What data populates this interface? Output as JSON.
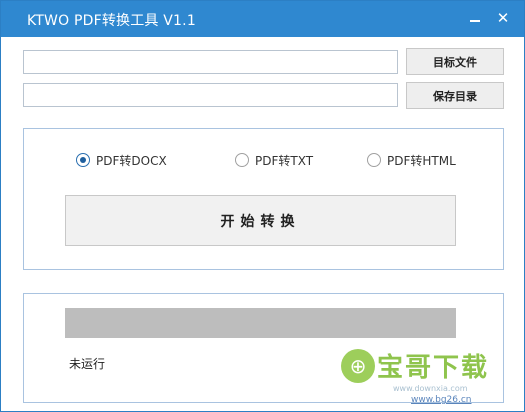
{
  "window": {
    "title": "KTWO PDF转换工具 V1.1",
    "close_glyph": "✕"
  },
  "inputs": {
    "target_path": "",
    "save_path": ""
  },
  "buttons": {
    "target_file": "目标文件",
    "save_dir": "保存目录",
    "start": "开始转换"
  },
  "options": [
    {
      "label": "PDF转DOCX",
      "checked": true
    },
    {
      "label": "PDF转TXT",
      "checked": false
    },
    {
      "label": "PDF转HTML",
      "checked": false
    }
  ],
  "progress": {
    "value": 1.0,
    "status": "未运行"
  },
  "watermark": {
    "logo_glyph": "⊕",
    "brand": "宝哥下载",
    "site_line1": "www.downxia.com",
    "site_line2": "www.bg26.cn"
  },
  "colors": {
    "titlebar": "#2f88d0",
    "panel_border": "#a9c3e0",
    "progress_fill": "#bdbdbd",
    "radio_checked": "#1f5f9e"
  }
}
